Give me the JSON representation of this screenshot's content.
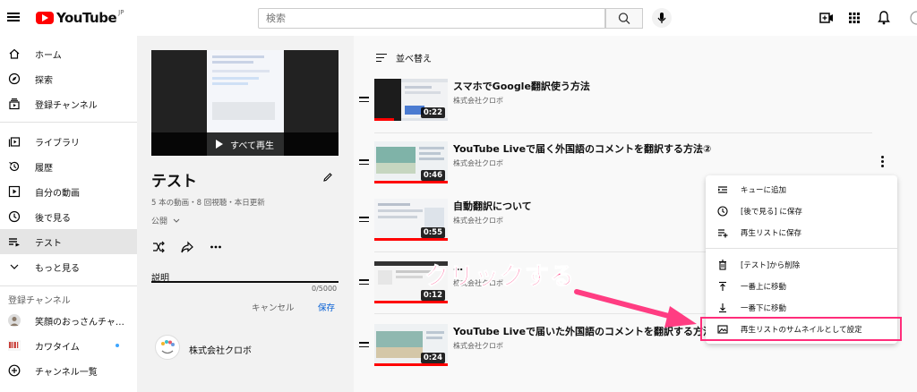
{
  "header": {
    "logo_text": "YouTube",
    "logo_region": "JP",
    "search_placeholder": "検索"
  },
  "sidebar": {
    "items": [
      {
        "label": "ホーム",
        "icon": "home-icon"
      },
      {
        "label": "探索",
        "icon": "compass-icon"
      },
      {
        "label": "登録チャンネル",
        "icon": "subscriptions-icon"
      },
      {
        "label": "ライブラリ",
        "icon": "library-icon"
      },
      {
        "label": "履歴",
        "icon": "history-icon"
      },
      {
        "label": "自分の動画",
        "icon": "your-videos-icon"
      },
      {
        "label": "後で見る",
        "icon": "clock-icon"
      },
      {
        "label": "テスト",
        "icon": "playlist-icon",
        "active": true
      },
      {
        "label": "もっと見る",
        "icon": "chevron-down-icon"
      }
    ],
    "subscriptions_title": "登録チャンネル",
    "subscriptions": [
      {
        "label": "笑顔のおっさんチャ…"
      },
      {
        "label": "カワタイム",
        "new": true
      },
      {
        "label": "チャンネル一覧"
      }
    ]
  },
  "playlist": {
    "play_all_label": "すべて再生",
    "title": "テスト",
    "stats": "5 本の動画・8 回視聴・本日更新",
    "privacy": "公開",
    "description_label": "説明",
    "description_count": "0/5000",
    "cancel_label": "キャンセル",
    "save_label": "保存",
    "owner_name": "株式会社クロボ"
  },
  "list": {
    "sort_label": "並べ替え",
    "videos": [
      {
        "title": "スマホでGoogle翻訳使う方法",
        "channel": "株式会社クロボ",
        "duration": "0:22"
      },
      {
        "title": "YouTube Liveで届く外国語のコメントを翻訳する方法②",
        "channel": "株式会社クロボ",
        "duration": "0:46"
      },
      {
        "title": "自動翻訳について",
        "channel": "株式会社クロボ",
        "duration": "0:55"
      },
      {
        "title": "…",
        "channel": "株式会社クロボ",
        "duration": "0:12"
      },
      {
        "title": "YouTube Liveで届いた外国語のコメントを翻訳する方法",
        "channel": "株式会社クロボ",
        "duration": "0:24"
      }
    ]
  },
  "menu": {
    "items": [
      {
        "label": "キューに追加",
        "icon": "queue-icon"
      },
      {
        "label": "[後で見る] に保存",
        "icon": "clock-icon"
      },
      {
        "label": "再生リストに保存",
        "icon": "playlist-add-icon"
      },
      {
        "label": "[テスト]から削除",
        "icon": "trash-icon"
      },
      {
        "label": "一番上に移動",
        "icon": "move-top-icon"
      },
      {
        "label": "一番下に移動",
        "icon": "move-bottom-icon"
      },
      {
        "label": "再生リストのサムネイルとして設定",
        "icon": "image-icon"
      }
    ]
  },
  "annotation": {
    "callout": "クリックする",
    "color": "#ff3d82"
  }
}
